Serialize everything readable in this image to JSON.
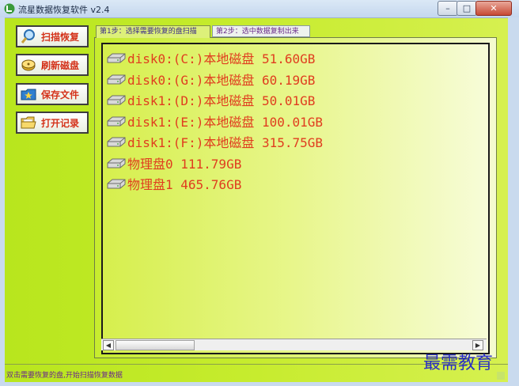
{
  "window": {
    "title": "流星数据恢复软件 v2.4",
    "min_glyph": "–",
    "max_glyph": "□",
    "close_glyph": "✕"
  },
  "sidebar": {
    "buttons": [
      {
        "label": "扫描恢复",
        "icon": "magnifier-icon"
      },
      {
        "label": "刷新磁盘",
        "icon": "disk-icon"
      },
      {
        "label": "保存文件",
        "icon": "folder-star-icon"
      },
      {
        "label": "打开记录",
        "icon": "folder-open-icon"
      }
    ]
  },
  "tabs": [
    {
      "label": "第1步：选择需要恢复的盘扫描",
      "active": true
    },
    {
      "label": "第2步：选中数据复制出来",
      "active": false
    }
  ],
  "disks": [
    "disk0:(C:)本地磁盘 51.60GB",
    "disk0:(G:)本地磁盘 60.19GB",
    "disk1:(D:)本地磁盘 50.01GB",
    "disk1:(E:)本地磁盘 100.01GB",
    "disk1:(F:)本地磁盘 315.75GB",
    "物理盘0 111.79GB",
    "物理盘1 465.76GB"
  ],
  "scrollbar": {
    "left_glyph": "◀",
    "right_glyph": "▶"
  },
  "status": "双击需要恢复的盘,开始扫描恢复数据",
  "watermark": "最需教育",
  "colors": {
    "accent_text": "#e03d1f",
    "background": "#c7ec2e",
    "watermark": "#2a2ec4"
  }
}
